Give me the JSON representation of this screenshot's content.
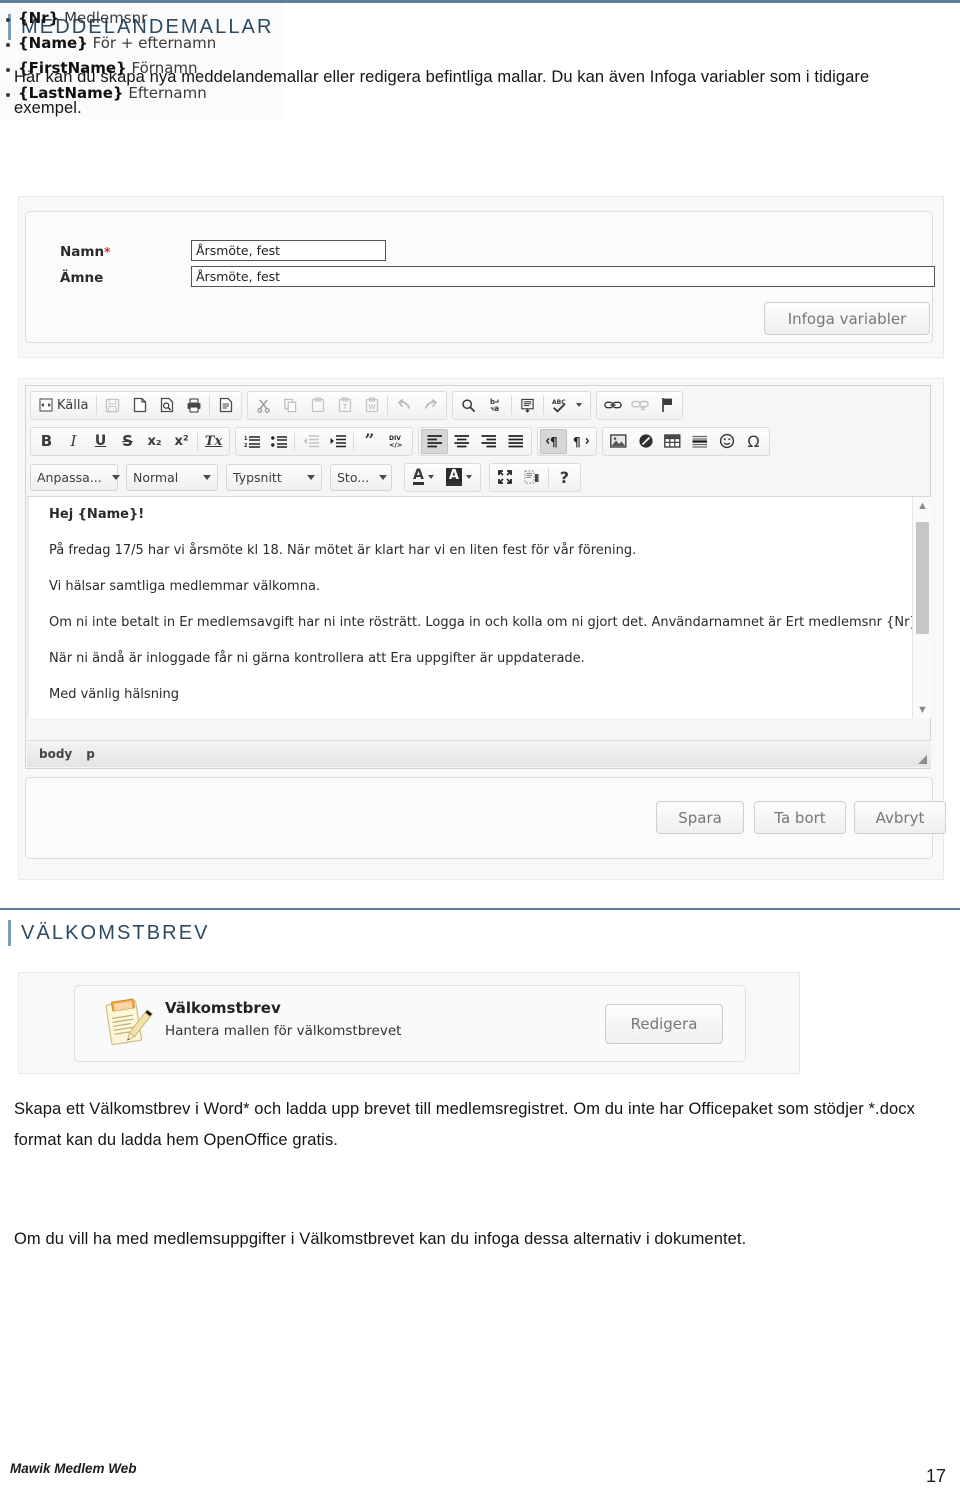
{
  "page": {
    "sections": [
      {
        "heading": "MEDDELANDEMALLAR"
      },
      {
        "heading": "VÄLKOMSTBREV"
      }
    ],
    "intro_paragraph": "Här kan du skapa nya meddelandemallar eller redigera befintliga mallar. Du kan även Infoga variabler som i tidigare exempel.",
    "welcome_paragraph_1": "Skapa ett Välkomstbrev i Word* och ladda upp brevet till medlemsregistret. Om du inte har Officepaket som stödjer *.docx format kan du ladda hem OpenOffice gratis.",
    "welcome_paragraph_2": "Om du vill ha med medlemsuppgifter i Välkomstbrevet kan du infoga dessa alternativ i dokumentet."
  },
  "form": {
    "name_label": "Namn",
    "name_required_mark": "*",
    "name_value": "Årsmöte, fest",
    "subject_label": "Ämne",
    "subject_value": "Årsmöte, fest",
    "insert_variables_button": "Infoga variabler"
  },
  "editor": {
    "toolbar_row1": [
      {
        "name": "source-button",
        "label": "Källa",
        "icon": "source-icon",
        "disabled": false
      },
      {
        "name": "save-button",
        "label": "",
        "icon": "floppy-disk-icon",
        "disabled": true
      },
      {
        "name": "new-page-button",
        "label": "",
        "icon": "new-page-icon",
        "disabled": false
      },
      {
        "name": "preview-button",
        "label": "",
        "icon": "preview-icon",
        "disabled": false
      },
      {
        "name": "print-button",
        "label": "",
        "icon": "printer-icon",
        "disabled": false
      },
      {
        "name": "templates-button",
        "label": "",
        "icon": "templates-icon",
        "disabled": false
      },
      {
        "name": "cut-button",
        "label": "",
        "icon": "scissors-icon",
        "disabled": true
      },
      {
        "name": "copy-button",
        "label": "",
        "icon": "copy-icon",
        "disabled": true
      },
      {
        "name": "paste-button",
        "label": "",
        "icon": "paste-icon",
        "disabled": true
      },
      {
        "name": "paste-text-button",
        "label": "",
        "icon": "paste-text-icon",
        "disabled": true
      },
      {
        "name": "paste-word-button",
        "label": "",
        "icon": "paste-word-icon",
        "disabled": true
      },
      {
        "name": "undo-button",
        "label": "",
        "icon": "undo-arrow-icon",
        "disabled": true
      },
      {
        "name": "redo-button",
        "label": "",
        "icon": "redo-arrow-icon",
        "disabled": true
      },
      {
        "name": "find-button",
        "label": "",
        "icon": "magnifier-icon",
        "disabled": false
      },
      {
        "name": "replace-button",
        "label": "",
        "icon": "replace-icon",
        "disabled": false
      },
      {
        "name": "select-all-button",
        "label": "",
        "icon": "select-all-icon",
        "disabled": false
      },
      {
        "name": "spellcheck-button",
        "label": "",
        "icon": "spellcheck-abc-icon",
        "disabled": false
      },
      {
        "name": "link-button",
        "label": "",
        "icon": "link-icon",
        "disabled": false
      },
      {
        "name": "unlink-button",
        "label": "",
        "icon": "unlink-icon",
        "disabled": true
      },
      {
        "name": "anchor-button",
        "label": "",
        "icon": "flag-anchor-icon",
        "disabled": false
      }
    ],
    "toolbar_row2": [
      {
        "name": "bold-button",
        "label": "B",
        "icon": "bold-icon"
      },
      {
        "name": "italic-button",
        "label": "I",
        "icon": "italic-icon"
      },
      {
        "name": "underline-button",
        "label": "U",
        "icon": "underline-icon"
      },
      {
        "name": "strike-button",
        "label": "S",
        "icon": "strikethrough-icon"
      },
      {
        "name": "subscript-button",
        "label": "x₂",
        "icon": "subscript-icon"
      },
      {
        "name": "superscript-button",
        "label": "x²",
        "icon": "superscript-icon"
      },
      {
        "name": "remove-format-button",
        "label": "Tx",
        "icon": "remove-format-icon"
      },
      {
        "name": "numbered-list-button",
        "label": "",
        "icon": "numbered-list-icon"
      },
      {
        "name": "bulleted-list-button",
        "label": "",
        "icon": "bulleted-list-icon"
      },
      {
        "name": "outdent-button",
        "label": "",
        "icon": "outdent-icon",
        "disabled": true
      },
      {
        "name": "indent-button",
        "label": "",
        "icon": "indent-icon"
      },
      {
        "name": "blockquote-button",
        "label": "",
        "icon": "blockquote-icon"
      },
      {
        "name": "div-container-button",
        "label": "",
        "icon": "div-container-icon"
      },
      {
        "name": "align-left-button",
        "label": "",
        "icon": "align-left-icon",
        "active": true
      },
      {
        "name": "align-center-button",
        "label": "",
        "icon": "align-center-icon"
      },
      {
        "name": "align-right-button",
        "label": "",
        "icon": "align-right-icon"
      },
      {
        "name": "align-justify-button",
        "label": "",
        "icon": "align-justify-icon"
      },
      {
        "name": "ltr-button",
        "label": "",
        "icon": "text-direction-ltr-icon",
        "active": true
      },
      {
        "name": "rtl-button",
        "label": "",
        "icon": "text-direction-rtl-icon"
      },
      {
        "name": "image-button",
        "label": "",
        "icon": "image-icon"
      },
      {
        "name": "flash-button",
        "label": "",
        "icon": "flash-icon"
      },
      {
        "name": "table-button",
        "label": "",
        "icon": "table-icon"
      },
      {
        "name": "horizontal-rule-button",
        "label": "",
        "icon": "horizontal-rule-icon"
      },
      {
        "name": "smiley-button",
        "label": "",
        "icon": "smiley-icon"
      },
      {
        "name": "special-char-button",
        "label": "Ω",
        "icon": "omega-icon"
      }
    ],
    "toolbar_row3_selects": [
      {
        "name": "styles-select",
        "value": "Anpassa..."
      },
      {
        "name": "paragraph-format-select",
        "value": "Normal"
      },
      {
        "name": "font-family-select",
        "value": "Typsnitt"
      },
      {
        "name": "font-size-select",
        "value": "Sto..."
      }
    ],
    "toolbar_row3_buttons": [
      {
        "name": "text-color-button",
        "label": "A",
        "icon": "text-color-icon"
      },
      {
        "name": "background-color-button",
        "label": "A",
        "icon": "background-color-icon"
      },
      {
        "name": "maximize-button",
        "label": "",
        "icon": "maximize-icon"
      },
      {
        "name": "show-blocks-button",
        "label": "",
        "icon": "show-blocks-icon"
      },
      {
        "name": "about-button",
        "label": "?",
        "icon": "question-mark-icon"
      }
    ],
    "document_paragraphs": [
      {
        "text": "Hej {Name}!",
        "bold": true
      },
      {
        "text": "På fredag 17/5 har vi årsmöte kl 18. När mötet är klart har vi en liten fest för vår förening.",
        "bold": false
      },
      {
        "text": "Vi hälsar samtliga medlemmar välkomna.",
        "bold": false
      },
      {
        "text": "Om ni inte betalt in Er medlemsavgift har ni inte rösträtt. Logga in och kolla om ni gjort det. Användarnamnet är Ert medlemsnr {Nr}",
        "bold": false
      },
      {
        "text": "När ni ändå är inloggade får ni gärna kontrollera att Era uppgifter är uppdaterade.",
        "bold": false
      },
      {
        "text": "Med vänlig hälsning",
        "bold": false
      }
    ],
    "element_path": [
      "body",
      "p"
    ],
    "footer_buttons": [
      {
        "name": "save-button",
        "label": "Spara"
      },
      {
        "name": "delete-button",
        "label": "Ta bort"
      },
      {
        "name": "cancel-button",
        "label": "Avbryt"
      }
    ]
  },
  "welcome_card": {
    "title": "Välkomstbrev",
    "subtitle": "Hantera mallen för välkomstbrevet",
    "edit_button": "Redigera",
    "icon": "note-pencil-icon"
  },
  "variables": [
    {
      "token": "{Nr}",
      "description": "Medlemsnr"
    },
    {
      "token": "{Name}",
      "description": "För + efternamn"
    },
    {
      "token": "{FirstName}",
      "description": "Förnamn"
    },
    {
      "token": "{LastName}",
      "description": "Efternamn"
    }
  ],
  "footer": {
    "brand": "Mawik Medlem Web",
    "page_number": "17"
  },
  "colors": {
    "accent_rule": "#5c7f9e",
    "heading": "#2a4a63",
    "required_star": "#cc3333"
  }
}
